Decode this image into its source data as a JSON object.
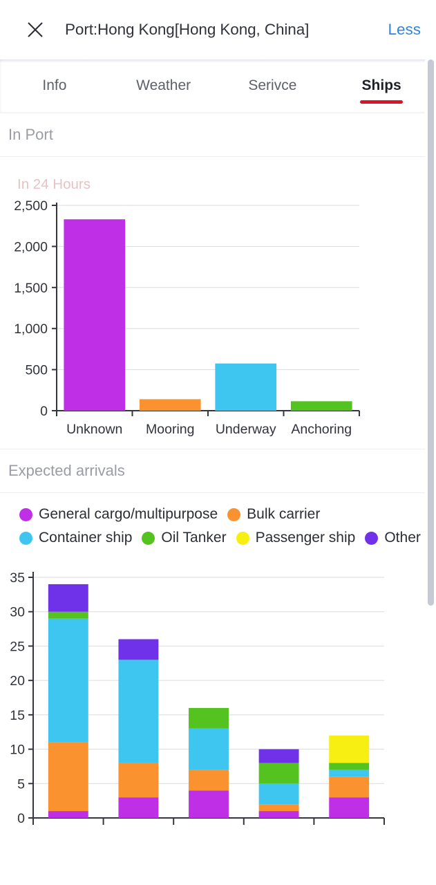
{
  "header": {
    "close_icon": "close-icon",
    "title": "Port:Hong Kong[Hong Kong, China]",
    "less_label": "Less"
  },
  "tabs": [
    {
      "label": "Info",
      "active": false
    },
    {
      "label": "Weather",
      "active": false
    },
    {
      "label": "Serivce",
      "active": false
    },
    {
      "label": "Ships",
      "active": true
    }
  ],
  "sections": {
    "in_port": "In Port",
    "expected_arrivals": "Expected arrivals"
  },
  "colors": {
    "accent_red": "#d9152c",
    "link_blue": "#2f86d8",
    "magenta": "#bf2fe5",
    "orange": "#f9922f",
    "sky_blue": "#3fc6f0",
    "green": "#54c21f",
    "yellow": "#f7ee12",
    "purple": "#6f32e8",
    "grid": "#d9dbdf",
    "axis": "#33363c",
    "section_text": "#9a9da4",
    "chart1_title": "#e6c3c4"
  },
  "legend": {
    "rows": [
      [
        {
          "label": "General cargo/multipurpose",
          "color": "#bf2fe5"
        },
        {
          "label": "Bulk carrier",
          "color": "#f9922f"
        }
      ],
      [
        {
          "label": "Container ship",
          "color": "#3fc6f0"
        },
        {
          "label": "Oil Tanker",
          "color": "#54c21f"
        },
        {
          "label": "Passenger ship",
          "color": "#f7ee12"
        },
        {
          "label": "Other",
          "color": "#6f32e8"
        }
      ]
    ]
  },
  "chart_data": [
    {
      "id": "in-24-hours",
      "type": "bar",
      "title": "In 24 Hours",
      "xlabel": "",
      "ylabel": "",
      "ylim": [
        0,
        2500
      ],
      "yticks": [
        0,
        500,
        1000,
        1500,
        2000,
        2500
      ],
      "ytick_labels": [
        "0",
        "500",
        "1,000",
        "1,500",
        "2,000",
        "2,500"
      ],
      "grid": true,
      "legend": "none",
      "categories": [
        "Unknown",
        "Mooring",
        "Underway",
        "Anchoring"
      ],
      "values": [
        2330,
        140,
        575,
        115
      ],
      "bar_colors": [
        "#bf2fe5",
        "#f9922f",
        "#3fc6f0",
        "#54c21f"
      ]
    },
    {
      "id": "expected-arrivals",
      "type": "bar",
      "stacked": true,
      "title": "Expected arrivals",
      "xlabel": "",
      "ylabel": "",
      "ylim": [
        0,
        35
      ],
      "yticks": [
        0,
        5,
        10,
        15,
        20,
        25,
        30,
        35
      ],
      "ytick_labels": [
        "0",
        "5",
        "10",
        "15",
        "20",
        "25",
        "30",
        "35"
      ],
      "grid": true,
      "legend": "top",
      "categories": [
        "",
        "",
        "",
        "",
        ""
      ],
      "series": [
        {
          "name": "General cargo/multipurpose",
          "color": "#bf2fe5",
          "values": [
            1,
            3,
            4,
            1,
            3
          ]
        },
        {
          "name": "Bulk carrier",
          "color": "#f9922f",
          "values": [
            10,
            5,
            3,
            1,
            3
          ]
        },
        {
          "name": "Container ship",
          "color": "#3fc6f0",
          "values": [
            18,
            15,
            6,
            3,
            1
          ]
        },
        {
          "name": "Oil Tanker",
          "color": "#54c21f",
          "values": [
            1,
            0,
            3,
            3,
            1
          ]
        },
        {
          "name": "Passenger ship",
          "color": "#f7ee12",
          "values": [
            0,
            0,
            0,
            0,
            4
          ]
        },
        {
          "name": "Other",
          "color": "#6f32e8",
          "values": [
            4,
            3,
            0,
            2,
            0
          ]
        }
      ],
      "totals": [
        34,
        26,
        16,
        10,
        12
      ]
    }
  ]
}
